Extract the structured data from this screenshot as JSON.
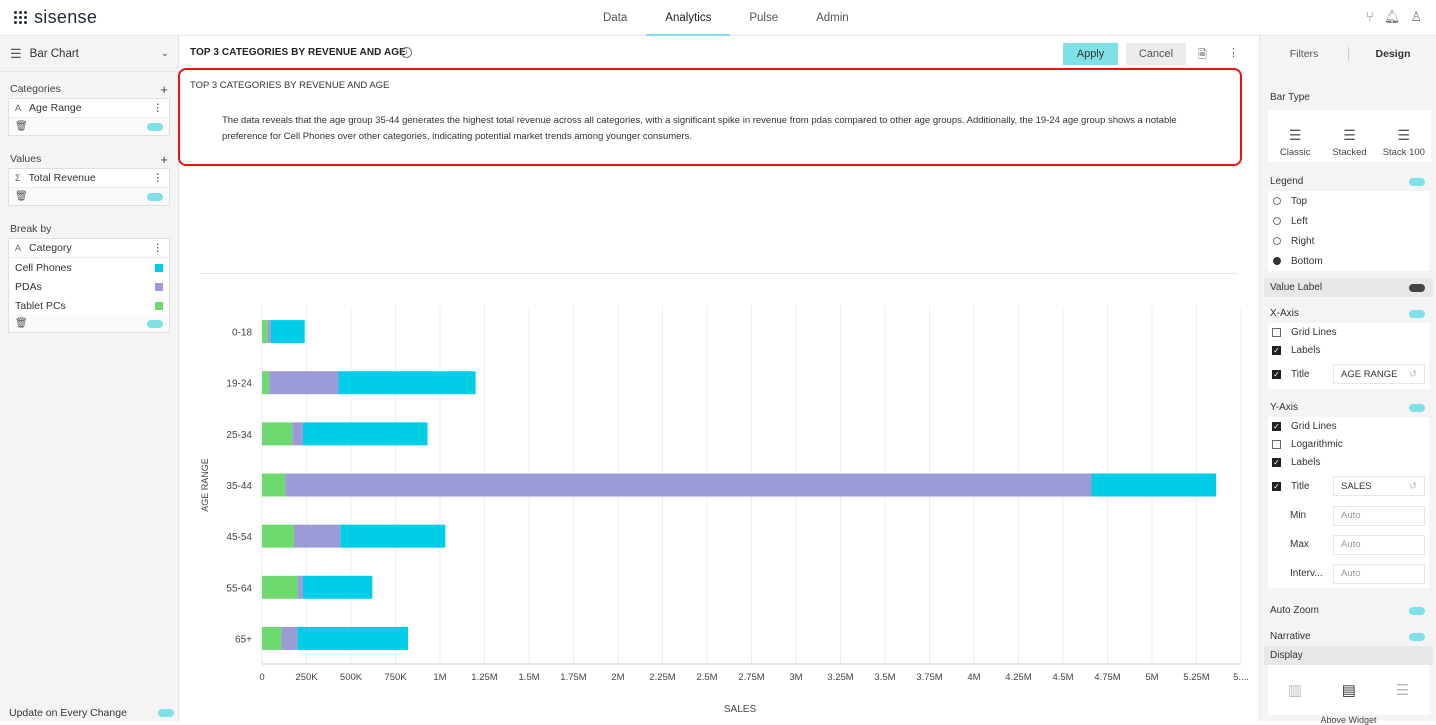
{
  "app": {
    "brand": "sisense",
    "nav": [
      "Data",
      "Analytics",
      "Pulse",
      "Admin"
    ],
    "active_nav": "Analytics"
  },
  "left": {
    "chart_type": "Bar Chart",
    "categories_label": "Categories",
    "categories_field": "Age Range",
    "values_label": "Values",
    "values_field": "Total Revenue",
    "breakby_label": "Break by",
    "breakby_field": "Category",
    "break_items": [
      {
        "label": "Cell Phones",
        "color": "#00cee6"
      },
      {
        "label": "PDAs",
        "color": "#9b9bd7"
      },
      {
        "label": "Tablet PCs",
        "color": "#6ed96e"
      }
    ],
    "update_label": "Update on Every Change"
  },
  "center": {
    "title": "TOP 3 CATEGORIES BY REVENUE AND AGE",
    "apply": "Apply",
    "cancel": "Cancel",
    "narrative_title": "TOP 3 CATEGORIES BY REVENUE AND AGE",
    "narrative_text": "The data reveals that the age group 35-44 generates the highest total revenue across all categories, with a significant spike in revenue from pdas compared to other age groups. Additionally, the 19-24 age group shows a notable preference for Cell Phones over other categories, indicating potential market trends among younger consumers."
  },
  "chart_data": {
    "type": "bar",
    "orientation": "horizontal",
    "stacked": true,
    "categories": [
      "0-18",
      "19-24",
      "25-34",
      "35-44",
      "45-54",
      "55-64",
      "65+"
    ],
    "series": [
      {
        "name": "Tablet PCs",
        "color": "#6ed96e",
        "values": [
          30000,
          40000,
          170000,
          130000,
          180000,
          200000,
          110000
        ]
      },
      {
        "name": "PDAs",
        "color": "#9b9bd7",
        "values": [
          20000,
          390000,
          60000,
          4530000,
          260000,
          30000,
          90000
        ]
      },
      {
        "name": "Cell Phones",
        "color": "#00cee6",
        "values": [
          190000,
          770000,
          700000,
          700000,
          590000,
          390000,
          620000
        ]
      }
    ],
    "xlabel": "SALES",
    "ylabel": "AGE RANGE",
    "xticks": [
      "0",
      "250K",
      "500K",
      "750K",
      "1M",
      "1.25M",
      "1.5M",
      "1.75M",
      "2M",
      "2.25M",
      "2.5M",
      "2.75M",
      "3M",
      "3.25M",
      "3.5M",
      "3.75M",
      "4M",
      "4.25M",
      "4.5M",
      "4.75M",
      "5M",
      "5.25M",
      "5...."
    ],
    "xlim": [
      0,
      5500000
    ],
    "legend": [
      "Cell Phones",
      "PDAs",
      "Tablet PCs"
    ],
    "legend_position": "bottom",
    "grid": true
  },
  "right": {
    "tab_filters": "Filters",
    "tab_design": "Design",
    "bar_type_label": "Bar Type",
    "bar_types": [
      "Classic",
      "Stacked",
      "Stack 100"
    ],
    "legend_label": "Legend",
    "legend_options": [
      "Top",
      "Left",
      "Right",
      "Bottom"
    ],
    "legend_selected": "Bottom",
    "value_label": "Value Label",
    "xaxis_label": "X-Axis",
    "xaxis": {
      "grid": "Grid Lines",
      "labels": "Labels",
      "title": "Title",
      "title_value": "AGE RANGE"
    },
    "yaxis_label": "Y-Axis",
    "yaxis": {
      "grid": "Grid Lines",
      "log": "Logarithmic",
      "labels": "Labels",
      "title": "Title",
      "title_value": "SALES",
      "min": "Min",
      "max": "Max",
      "interval": "Interv...",
      "auto": "Auto"
    },
    "auto_zoom": "Auto Zoom",
    "narrative": "Narrative",
    "display": "Display",
    "display_caption": "Above Widget"
  }
}
